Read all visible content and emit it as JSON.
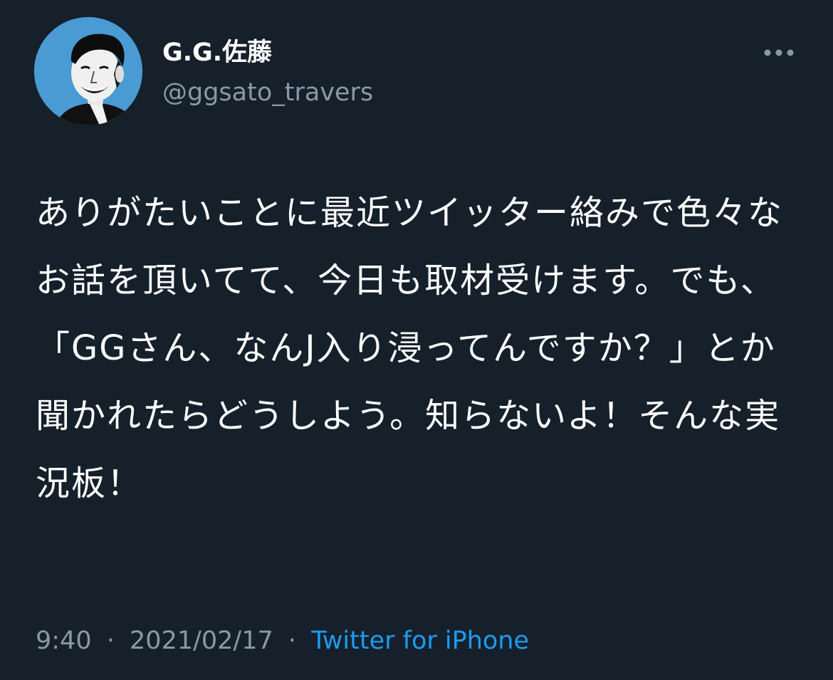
{
  "author": {
    "display_name": "G.G.佐藤",
    "handle": "@ggsato_travers",
    "avatar_icon": "profile-photo"
  },
  "more_icon": "more-dots-icon",
  "tweet": {
    "text": "ありがたいことに最近ツイッター絡みで色々なお話を頂いてて、今日も取材受けます。でも、「GGさん、なんJ入り浸ってんですか？」とか聞かれたらどうしよう。知らないよ！そんな実況板！"
  },
  "meta": {
    "time": "9:40",
    "separator": "·",
    "date": "2021/02/17",
    "source": "Twitter for iPhone"
  },
  "colors": {
    "background": "#15202b",
    "text": "#ffffff",
    "secondary_text": "#8b98a5",
    "link": "#1d9bf0",
    "avatar_bg": "#4a9ad4"
  }
}
